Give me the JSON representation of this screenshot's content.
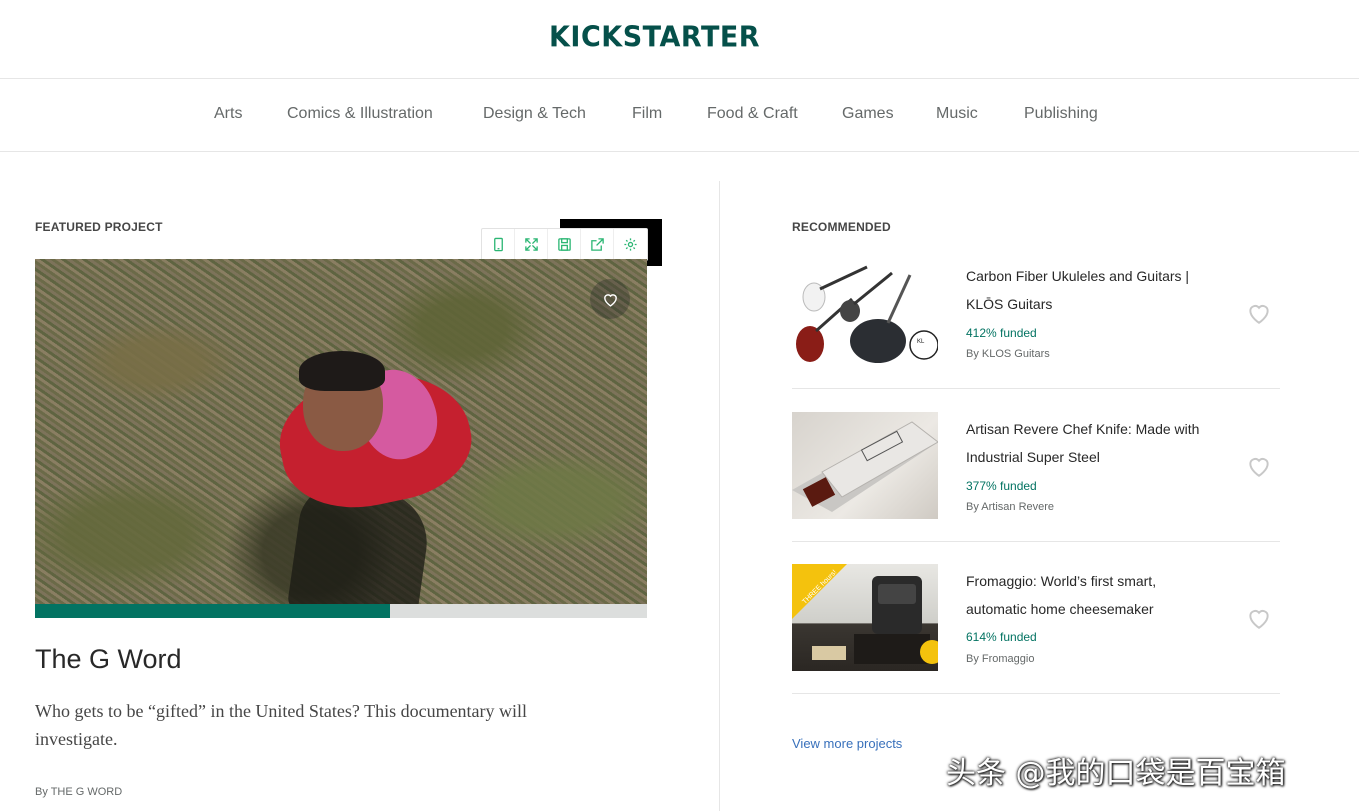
{
  "header": {
    "logo_text": "KICKSTARTER"
  },
  "nav": {
    "items": [
      {
        "label": "Arts"
      },
      {
        "label": "Comics & Illustration"
      },
      {
        "label": "Design & Tech"
      },
      {
        "label": "Film"
      },
      {
        "label": "Food & Craft"
      },
      {
        "label": "Games"
      },
      {
        "label": "Music"
      },
      {
        "label": "Publishing"
      }
    ]
  },
  "featured": {
    "section_label": "FEATURED PROJECT",
    "title": "The G Word",
    "description": "Who gets to be “gifted” in the United States? This documentary will investigate.",
    "byline": "By THE G WORD",
    "progress_fraction": 0.58,
    "toolbar": {
      "icons": [
        "phone-icon",
        "expand-icon",
        "save-icon",
        "share-icon",
        "settings-icon"
      ]
    }
  },
  "recommended": {
    "section_label": "RECOMMENDED",
    "items": [
      {
        "title": "Carbon Fiber Ukuleles and Guitars | KLŌS Guitars",
        "funded": "412% funded",
        "byline": "By KLOS Guitars",
        "thumb_text": "KL"
      },
      {
        "title": "Artisan Revere Chef Knife: Made with Industrial Super Steel",
        "funded": "377% funded",
        "byline": "By Artisan Revere"
      },
      {
        "title": "Fromaggio: World’s first smart, automatic home cheesemaker",
        "funded": "614% funded",
        "byline": "By Fromaggio",
        "thumb_text": "THREE hours!"
      }
    ],
    "view_more": "View more projects"
  },
  "watermark": "头条 @我的口袋是百宝箱",
  "colors": {
    "brand": "#05504a",
    "funded_green": "#037362",
    "link_blue": "#3870bb"
  }
}
